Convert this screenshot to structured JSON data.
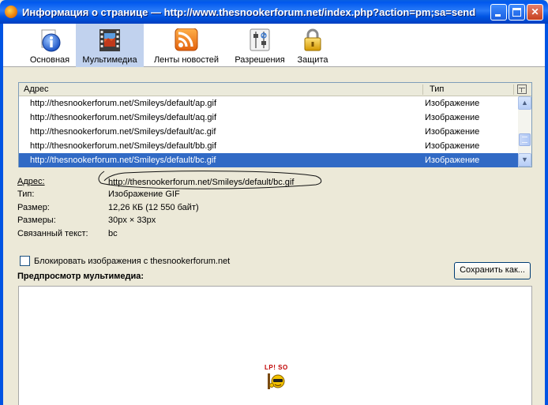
{
  "window": {
    "title": "Информация о странице — http://www.thesnookerforum.net/index.php?action=pm;sa=send",
    "minimize_glyph": "_",
    "maximize_glyph": "□",
    "close_glyph": "✕"
  },
  "toolbar": {
    "tabs": [
      {
        "label": "Основная",
        "icon": "info-icon"
      },
      {
        "label": "Мультимедиа",
        "icon": "film-image-icon",
        "active": true
      },
      {
        "label": "Ленты новостей",
        "icon": "rss-feed-icon"
      },
      {
        "label": "Разрешения",
        "icon": "permissions-sliders-icon"
      },
      {
        "label": "Защита",
        "icon": "padlock-icon"
      }
    ]
  },
  "media_list": {
    "columns": {
      "address": "Адрес",
      "type": "Тип"
    },
    "rows": [
      {
        "address": "http://thesnookerforum.net/Smileys/default/ap.gif",
        "type": "Изображение"
      },
      {
        "address": "http://thesnookerforum.net/Smileys/default/aq.gif",
        "type": "Изображение"
      },
      {
        "address": "http://thesnookerforum.net/Smileys/default/ac.gif",
        "type": "Изображение"
      },
      {
        "address": "http://thesnookerforum.net/Smileys/default/bb.gif",
        "type": "Изображение"
      },
      {
        "address": "http://thesnookerforum.net/Smileys/default/bc.gif",
        "type": "Изображение",
        "selected": true
      }
    ],
    "scroll_up_glyph": "▲",
    "scroll_down_glyph": "▼"
  },
  "details": {
    "address_label": "Адрес:",
    "address_value": "http://thesnookerforum.net/Smileys/default/bc.gif",
    "type_label": "Тип:",
    "type_value": "Изображение GIF",
    "size_label": "Размер:",
    "size_value": "12,26 КБ (12 550 байт)",
    "dimensions_label": "Размеры:",
    "dimensions_value": "30px × 33px",
    "alt_text_label": "Связанный текст:",
    "alt_text_value": "bc"
  },
  "block_images": {
    "label": "Блокировать изображения с thesnookerforum.net",
    "checked": false
  },
  "save_button_label": "Сохранить как...",
  "preview": {
    "title": "Предпросмотр мультимедиа:",
    "smiley_sign": "LP! SO"
  },
  "colors": {
    "selection": "#316ac5",
    "titlebar": "#0054e3",
    "dialog_bg": "#ece9d8"
  }
}
